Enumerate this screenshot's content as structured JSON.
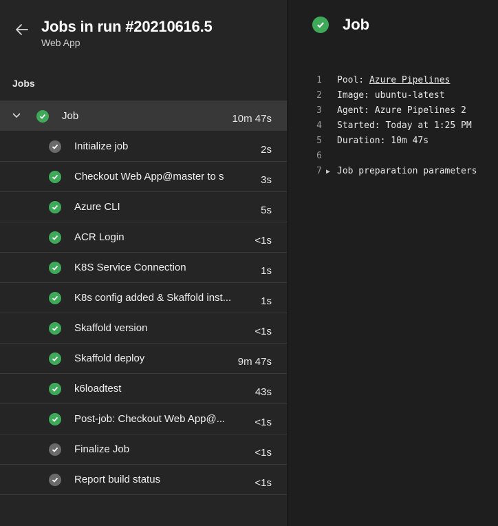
{
  "header": {
    "title": "Jobs in run #20210616.5",
    "subtitle": "Web App"
  },
  "section_label": "Jobs",
  "job": {
    "label": "Job",
    "duration": "10m 47s",
    "status": "succeeded"
  },
  "steps": [
    {
      "label": "Initialize job",
      "duration": "2s",
      "status": "skipped"
    },
    {
      "label": "Checkout Web App@master to s",
      "duration": "3s",
      "status": "succeeded"
    },
    {
      "label": "Azure CLI",
      "duration": "5s",
      "status": "succeeded"
    },
    {
      "label": "ACR Login",
      "duration": "<1s",
      "status": "succeeded"
    },
    {
      "label": "K8S Service Connection",
      "duration": "1s",
      "status": "succeeded"
    },
    {
      "label": "K8s config added & Skaffold inst...",
      "duration": "1s",
      "status": "succeeded"
    },
    {
      "label": "Skaffold version",
      "duration": "<1s",
      "status": "succeeded"
    },
    {
      "label": "Skaffold deploy",
      "duration": "9m 47s",
      "status": "succeeded"
    },
    {
      "label": "k6loadtest",
      "duration": "43s",
      "status": "succeeded"
    },
    {
      "label": "Post-job: Checkout Web App@...",
      "duration": "<1s",
      "status": "succeeded"
    },
    {
      "label": "Finalize Job",
      "duration": "<1s",
      "status": "skipped"
    },
    {
      "label": "Report build status",
      "duration": "<1s",
      "status": "skipped"
    }
  ],
  "detail": {
    "title": "Job",
    "log": {
      "l1": {
        "num": "1",
        "prefix": "Pool: ",
        "link": "Azure Pipelines"
      },
      "l2": {
        "num": "2",
        "text": "Image: ubuntu-latest"
      },
      "l3": {
        "num": "3",
        "text": "Agent: Azure Pipelines 2"
      },
      "l4": {
        "num": "4",
        "text": "Started: Today at 1:25 PM"
      },
      "l5": {
        "num": "5",
        "text": "Duration: 10m 47s"
      },
      "l6": {
        "num": "6",
        "text": ""
      },
      "l7": {
        "num": "7",
        "text": "Job preparation parameters"
      }
    }
  },
  "colors": {
    "success": "#3fa95a",
    "skipped": "#6a6a6a",
    "selected_row": "#383838"
  }
}
